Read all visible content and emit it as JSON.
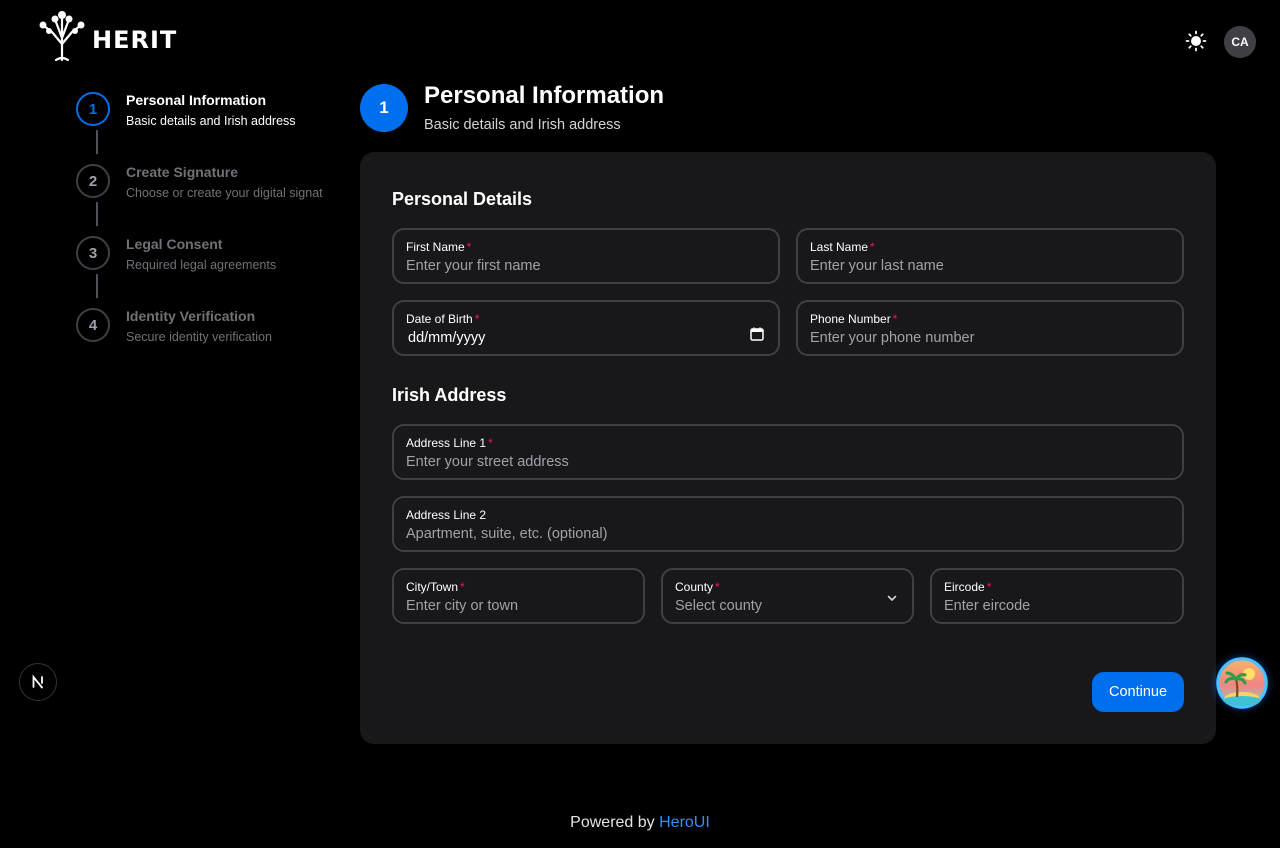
{
  "header": {
    "logo_text": "HERIT",
    "avatar_initials": "CA"
  },
  "stepper": [
    {
      "number": "1",
      "title": "Personal Information",
      "description": "Basic details and Irish address",
      "active": true
    },
    {
      "number": "2",
      "title": "Create Signature",
      "description": "Choose or create your digital signat",
      "active": false
    },
    {
      "number": "3",
      "title": "Legal Consent",
      "description": "Required legal agreements",
      "active": false
    },
    {
      "number": "4",
      "title": "Identity Verification",
      "description": "Secure identity verification",
      "active": false
    }
  ],
  "section": {
    "number": "1",
    "title": "Personal Information",
    "subtitle": "Basic details and Irish address"
  },
  "form": {
    "personal_details_title": "Personal Details",
    "irish_address_title": "Irish Address",
    "required_marker": "*",
    "first_name": {
      "label": "First Name",
      "placeholder": "Enter your first name"
    },
    "last_name": {
      "label": "Last Name",
      "placeholder": "Enter your last name"
    },
    "dob": {
      "label": "Date of Birth",
      "value": "dd/mm/yyyy"
    },
    "phone": {
      "label": "Phone Number",
      "placeholder": "Enter your phone number"
    },
    "address1": {
      "label": "Address Line 1",
      "placeholder": "Enter your street address"
    },
    "address2": {
      "label": "Address Line 2",
      "placeholder": "Apartment, suite, etc. (optional)"
    },
    "city": {
      "label": "City/Town",
      "placeholder": "Enter city or town"
    },
    "county": {
      "label": "County",
      "placeholder": "Select county"
    },
    "eircode": {
      "label": "Eircode",
      "placeholder": "Enter eircode"
    },
    "continue_label": "Continue"
  },
  "footer": {
    "prefix": "Powered by",
    "link": "HeroUI"
  },
  "colors": {
    "accent": "#006FEE",
    "required": "#F31260",
    "card_bg": "#18181B",
    "border": "#3F3F46"
  }
}
